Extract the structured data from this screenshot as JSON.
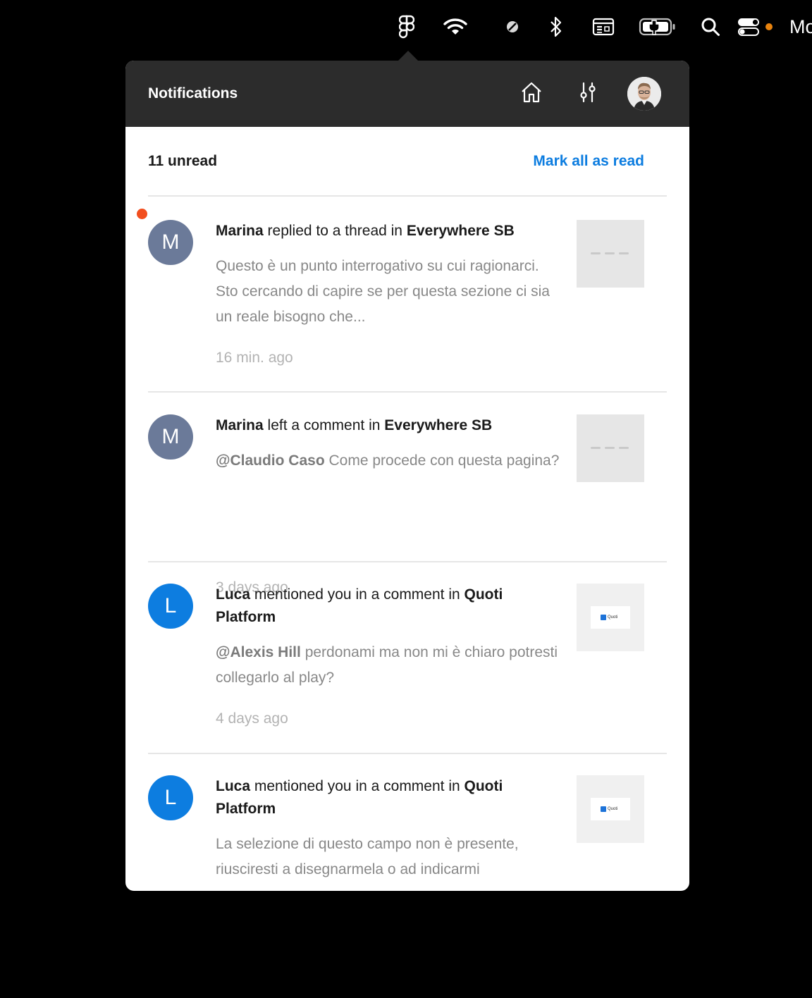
{
  "menubar": {
    "icons": [
      "figma-icon",
      "wifi-icon",
      "no-entry-icon",
      "bluetooth-icon",
      "keyboard-shortcuts-icon",
      "battery-charging-icon",
      "search-icon",
      "control-center-icon"
    ],
    "status_dot_color": "#e8830e",
    "clipped_text": "Mo"
  },
  "panel": {
    "title": "Notifications",
    "header_buttons": [
      "home-icon",
      "settings-sliders-icon",
      "user-avatar"
    ],
    "unread_label": "11 unread",
    "mark_all_label": "Mark all as read",
    "accent_color": "#0d7de0",
    "unread_dot_color": "#f24e1e"
  },
  "notifications": [
    {
      "unread": true,
      "avatar_letter": "M",
      "avatar_color": "#6b7a99",
      "actor": "Marina",
      "action": " replied to a thread in ",
      "target": "Everywhere SB",
      "mention": "",
      "body": "Questo è un punto interrogativo su cui ragionarci. Sto cercando di capire se per questa sezione ci sia un reale bisogno che...",
      "time": "16 min. ago",
      "thumbnail": "grey-placeholder"
    },
    {
      "unread": false,
      "avatar_letter": "M",
      "avatar_color": "#6b7a99",
      "actor": "Marina",
      "action": " left a comment in ",
      "target": "Everywhere SB",
      "mention": "@Claudio Caso",
      "body": " Come procede con questa pagina?",
      "time": "3 days ago",
      "thumbnail": "grey-placeholder"
    },
    {
      "unread": false,
      "avatar_letter": "L",
      "avatar_color": "#0d7de0",
      "actor": "Luca",
      "action": " mentioned you in a comment in ",
      "target": "Quoti Platform",
      "mention": "@Alexis Hill",
      "body": " perdonami ma non mi è chiaro potresti collegarlo al play?",
      "time": "4 days ago",
      "thumbnail": "quoti-card",
      "thumb_text": "Quoti"
    },
    {
      "unread": false,
      "avatar_letter": "L",
      "avatar_color": "#0d7de0",
      "actor": "Luca",
      "action": " mentioned you in a comment in ",
      "target": "Quoti Platform",
      "mention": "",
      "body": "La selezione di questo campo non è presente, riusciresti a disegnarmela o ad indicarmi",
      "time": "",
      "thumbnail": "quoti-card",
      "thumb_text": "Quoti"
    }
  ]
}
